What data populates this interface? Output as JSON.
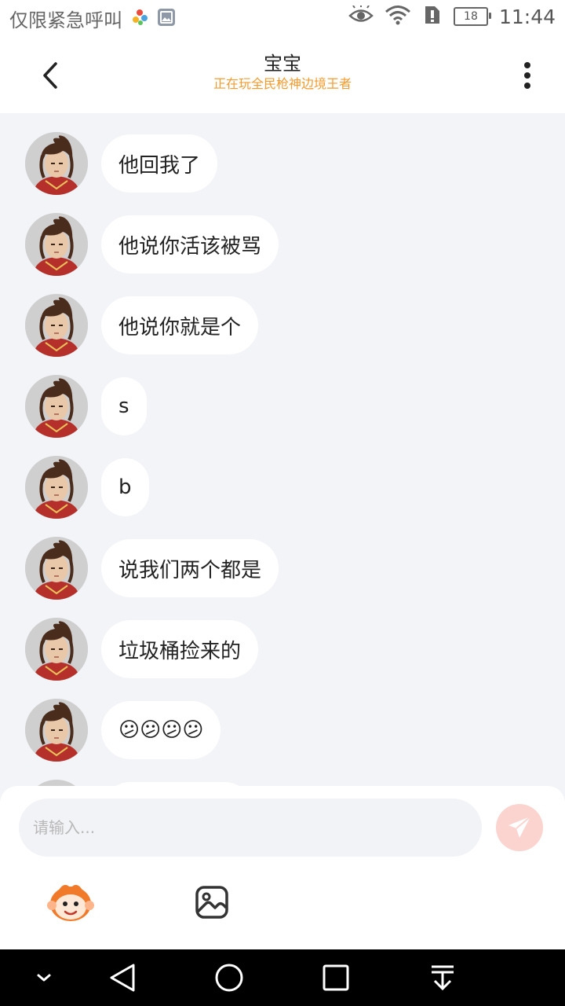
{
  "status_bar": {
    "left_text": "仅限紧急呼叫",
    "battery": "18",
    "time": "11:44"
  },
  "header": {
    "title": "宝宝",
    "subtitle": "正在玩全民枪神边境王者"
  },
  "messages": [
    {
      "text": "他回我了"
    },
    {
      "text": "他说你活该被骂"
    },
    {
      "text": "他说你就是个"
    },
    {
      "text": "s"
    },
    {
      "text": "b"
    },
    {
      "text": "说我们两个都是"
    },
    {
      "text": "垃圾桶捡来的"
    },
    {
      "text": "😕😕😕😕"
    }
  ],
  "composer": {
    "placeholder": "请输入..."
  },
  "colors": {
    "accent": "#f29b2e",
    "send_button": "#fbd3cf",
    "background": "#f3f4f7"
  },
  "icons": {
    "back": "chevron-left-icon",
    "more": "more-vertical-icon",
    "send": "paper-plane-icon",
    "emoji": "monkey-emoji-icon",
    "image": "image-icon"
  }
}
